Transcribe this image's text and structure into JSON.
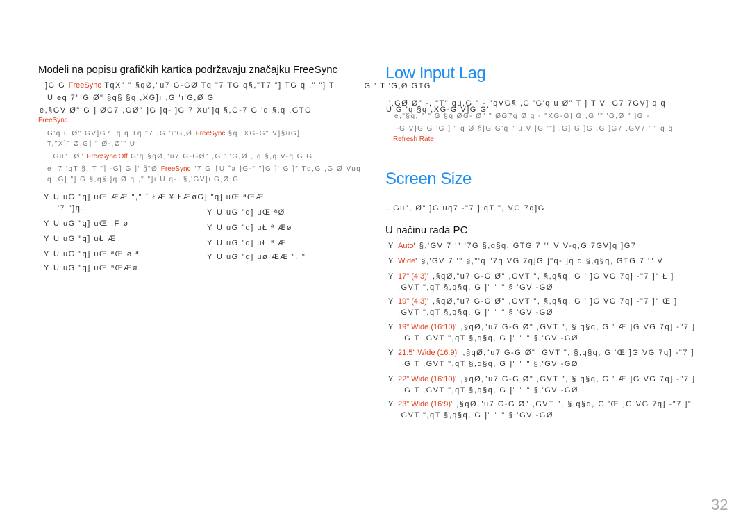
{
  "left": {
    "heading": "Modeli na popisu grafičkih kartica podržavaju značajku FreeSync",
    "p1a": "]G G ",
    "p1r": "FreeSync",
    "p1b": " TqX\"  \"  §qØ,\"u7 G-GØ    Tq \"7 TG q§,\"T7 \"] TG q ,\" \"] T",
    "p1c": "U  eq 7\" G Ø\" §q§   §q ,XG]ı ,G   'ı'G,Ø  G'",
    "p2": "e,§GV Ø\"  G  ] ØG7 ,GØ\" ]G ]q-     ]G      7 Xu\"]q   §,G-7 G 'q  §,q ,GTG",
    "p2r": "FreeSync",
    "n1a": "G'q u  Ø\"  GV]G7  'q     q  Tq \"7    ,G    'ı'G,Ø ",
    "n1r": "FreeSync",
    "n1b": " §q ,XG-G\"  V]§uG]",
    "n1c": "T,\"X]\"  Ø,G]  \" Ø-,Ø'\"   U",
    "n2a": ". Gu\", Ø\" ",
    "n2r": "FreeSync Off",
    "n2b": " G'q  §qØ,\"u7 G-GØ\"  ,G   '  'G,Ø     ,  q  §,q V-q G G",
    "n3a": "e, 7 'qT §, T \"]  -G] G   ]' §\"Ø ",
    "n3r": "FreeSync",
    "n3b": " \"7 G †U ˆa ]G-\" \"]G   ]'   G ]\" Tq,G ,G  Ø  Vuq",
    "n3c": "q ,G]  \"] G §,q§  ]q Ø  q ,\" \"]ı   U q-ı §,'GV]ı'G,Ø  G",
    "list_a": [
      {
        "text": "U  uG \"q] uŒ  ÆÆ  \",\"  ˝ ŁÆ ¥  ŁÆøG] \"q] uŒ ªŒÆ",
        "cont": "'7   \"]q."
      },
      {
        "text": "U  uG \"q] uŒ   ,F ø"
      },
      {
        "text": "U  uG \"q] uŁ   Æ"
      },
      {
        "text": "U  uG \"q] uŒ ªŒ ø ª"
      },
      {
        "text": "U  uG \"q] uŒ ªŒÆø"
      }
    ],
    "list_b": [
      {
        "text": "U  uG \"q] uŒ ªØ"
      },
      {
        "text": "U  uG \"q] uŁ ª Æø"
      },
      {
        "text": "U  uG \"q] uŁ ª Æ"
      },
      {
        "text": "U  uG \"q] uø  ÆÆ   \", \""
      }
    ],
    "bullet": "Y"
  },
  "right": {
    "title1": "Low Input Lag",
    "l1": "',GØ Ø\" -,  \"T\" qu,G \" -  \"qVG§ ,G 'G'q u  Ø\" T ] T V ,G7   7GV]  q  q",
    "l2": "U  G 'q   §q ,XG-G V]G G'",
    "l0": ",G   ' T 'G,Ø  GTG",
    "g1": "e,\"§q,    \"  \"  G §q ØG- Ø\"   \" ØG7q Ø q - \"XG-G] G  ,G   '\" 'G,Ø  \" ]G -,",
    "g2": ".-G V]G G 'G ]  \"   q Ø §]G G'q  \" u,V ]G  '\"] ,G] G ]G ,G  ]G7  ,GV7 '  \" q  q",
    "g2r": "Refresh Rate",
    "title2": "Screen Size",
    "s1": ". Gu\", Ø\" ]G uq7   -\"7   ]    qT \", VG 7q]G",
    "sub": "U načinu rada PC",
    "items": [
      {
        "label": "Auto",
        "text": "' §,'GV  7 '\"   '7G    §,q§q,   GTG  7 '\"  V  V-q,G  7GV]q    ]G7"
      },
      {
        "label": "Wide",
        "text": "' §,'GV  7 '\" §,\"'q    \"7q  VG 7q]G ]\"q-  ]q q §,q§q,   GTG  7 '\"  V"
      },
      {
        "label": "17\" (4:3)",
        "text": "' ,§qØ,\"u7 G-G Ø\" ,GVT \", §,q§q,   G  '  ]G VG 7q]  -\"7   ]\"  Ł  ]",
        "cont": ",GVT \",qT §,q§q,   G ]\" \"  \" §,'GV -GØ"
      },
      {
        "label": "19\" (4:3)",
        "text": "' ,§qØ,\"u7 G-G Ø\" ,GVT \", §,q§q,   G  '  ]G VG 7q]  -\"7   ]\"  Œ  ]",
        "cont": ",GVT \",qT §,q§q,   G ]\" \"  \" §,'GV -GØ"
      },
      {
        "label": "19\" Wide (16:10)",
        "text": "' ,§qØ,\"u7 G-G Ø\" ,GVT \", §,q§q,   G  ' Æ ]G VG 7q]  -\"7   ]",
        "cont": ",  G    T ,GVT \",qT §,q§q,   G ]\" \"  \" §,'GV -GØ"
      },
      {
        "label": "21.5\" Wide (16:9)",
        "text": "' ,§qØ,\"u7 G-G Ø\" ,GVT \", §,q§q,   G  'Œ ]G VG 7q]  -\"7   ]",
        "cont": ",  G    T ,GVT \",qT §,q§q,   G ]\" \"  \" §,'GV -GØ"
      },
      {
        "label": "22\" Wide (16:10)",
        "text": "' ,§qØ,\"u7 G-G Ø\" ,GVT \", §,q§q,   G  ' Æ ]G VG 7q]  -\"7   ]",
        "cont": ",  G    T ,GVT \",qT §,q§q,   G ]\" \"  \" §,'GV -GØ"
      },
      {
        "label": "23\" Wide (16:9)",
        "text": "' ,§qØ,\"u7 G-G Ø\" ,GVT \", §,q§q,   G  'Œ ]G VG 7q]  -\"7   ]\"",
        "cont": ",GVT \",qT §,q§q,   G ]\" \"  \" §,'GV -GØ"
      }
    ]
  },
  "page_number": "32",
  "colors": {
    "accent": "#1f8ef1",
    "highlight": "#e0401c"
  }
}
